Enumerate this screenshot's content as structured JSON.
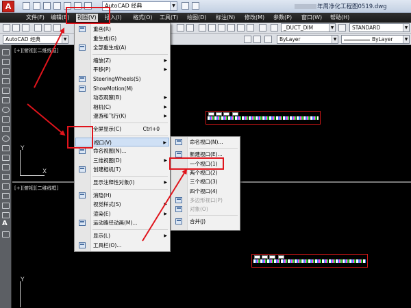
{
  "app": {
    "logo_letter": "A",
    "workspace": "AutoCAD 经典",
    "document_title": "年周净化工程图0519.dwg"
  },
  "menubar": [
    {
      "label": "文件(F)"
    },
    {
      "label": "编辑(E)"
    },
    {
      "label": "视图(V)",
      "active": true
    },
    {
      "label": "插入(I)"
    },
    {
      "label": "格式(O)"
    },
    {
      "label": "工具(T)"
    },
    {
      "label": "绘图(D)"
    },
    {
      "label": "标注(N)"
    },
    {
      "label": "修改(M)"
    },
    {
      "label": "参数(P)"
    },
    {
      "label": "窗口(W)"
    },
    {
      "label": "帮助(H)"
    }
  ],
  "toolbar": {
    "dimstyle": "_DUCT_DIM",
    "textstyle": "STANDARD",
    "workspace_combo": "AutoCAD 经典",
    "color_combo": "ByLayer",
    "linetype_combo": "ByLayer"
  },
  "viewports": {
    "top_label": "[+][俯视][二维线框]",
    "bottom_label": "[+][俯视][二维线框]",
    "ucs_x": "X",
    "ucs_y": "Y"
  },
  "view_menu": [
    {
      "label": "重画(R)",
      "icon": "redraw-icon"
    },
    {
      "label": "重生成(G)"
    },
    {
      "label": "全部重生成(A)",
      "icon": "regen-all-icon"
    },
    {
      "sep": true
    },
    {
      "label": "缩放(Z)",
      "submenu": true
    },
    {
      "label": "平移(P)",
      "submenu": true
    },
    {
      "label": "SteeringWheels(S)",
      "icon": "steering-wheel-icon"
    },
    {
      "label": "ShowMotion(M)",
      "icon": "showmotion-icon"
    },
    {
      "label": "动态观察(B)",
      "submenu": true
    },
    {
      "label": "相机(C)",
      "submenu": true
    },
    {
      "label": "漫游和飞行(K)",
      "submenu": true
    },
    {
      "sep": true
    },
    {
      "label": "全屏显示(C)",
      "shortcut": "Ctrl+0"
    },
    {
      "sep": true
    },
    {
      "label": "视口(V)",
      "submenu": true,
      "highlighted": true
    },
    {
      "label": "命名视图(N)...",
      "icon": "named-view-icon"
    },
    {
      "label": "三维视图(D)",
      "submenu": true
    },
    {
      "label": "创建相机(T)",
      "icon": "camera-icon"
    },
    {
      "sep": true
    },
    {
      "label": "显示注释性对象(I)",
      "submenu": true
    },
    {
      "sep": true
    },
    {
      "label": "消隐(H)",
      "icon": "hide-icon"
    },
    {
      "label": "视觉样式(S)",
      "submenu": true
    },
    {
      "label": "渲染(E)",
      "submenu": true
    },
    {
      "label": "运动路径动画(M)...",
      "icon": "motion-path-icon"
    },
    {
      "sep": true
    },
    {
      "label": "显示(L)",
      "submenu": true
    },
    {
      "label": "工具栏(O)...",
      "icon": "toolbar-icon"
    }
  ],
  "viewports_submenu": [
    {
      "label": "命名视口(N)...",
      "icon": "named-viewport-icon"
    },
    {
      "sep": true
    },
    {
      "label": "新建视口(E)...",
      "icon": "new-viewport-icon"
    },
    {
      "label": "一个视口(1)",
      "boxed": true
    },
    {
      "label": "两个视口(2)"
    },
    {
      "label": "三个视口(3)"
    },
    {
      "label": "四个视口(4)"
    },
    {
      "label": "多边形视口(P)",
      "disabled": true,
      "icon": "polygon-viewport-icon"
    },
    {
      "label": "对象(O)",
      "disabled": true,
      "icon": "object-viewport-icon"
    },
    {
      "sep": true
    },
    {
      "label": "合并(J)",
      "icon": "join-icon"
    }
  ],
  "colors": {
    "annotation_red": "#e0141c",
    "menu_highlight": "#cfe0f5",
    "logo_red": "#c8211a"
  }
}
